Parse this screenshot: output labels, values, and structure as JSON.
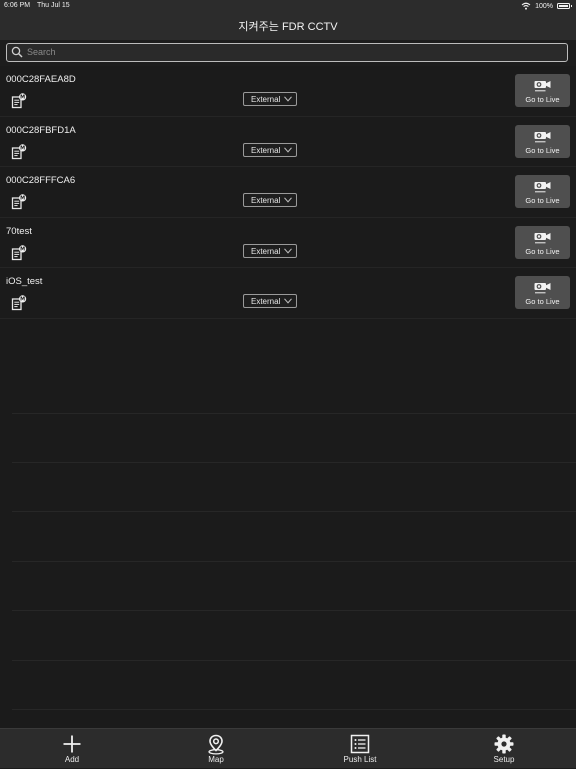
{
  "status_bar": {
    "time": "6:06 PM",
    "date": "Thu Jul 15",
    "battery": "100%"
  },
  "nav": {
    "title": "지켜주는 FDR CCTV"
  },
  "search": {
    "placeholder": "Search",
    "value": ""
  },
  "devices": [
    {
      "name": "000C28FAEA8D",
      "mode": "External",
      "action_label": "Go to Live"
    },
    {
      "name": "000C28FBFD1A",
      "mode": "External",
      "action_label": "Go to Live"
    },
    {
      "name": "000C28FFFCA6",
      "mode": "External",
      "action_label": "Go to Live"
    },
    {
      "name": "70test",
      "mode": "External",
      "action_label": "Go to Live"
    },
    {
      "name": "iOS_test",
      "mode": "External",
      "action_label": "Go to Live"
    }
  ],
  "tabs": [
    {
      "label": "Add",
      "icon": "plus-icon"
    },
    {
      "label": "Map",
      "icon": "map-pin-icon"
    },
    {
      "label": "Push List",
      "icon": "list-icon"
    },
    {
      "label": "Setup",
      "icon": "gear-icon"
    }
  ],
  "icons": {
    "memo": "memo-m-icon",
    "camera": "cctv-camera-icon",
    "wifi": "wifi-icon",
    "battery": "battery-icon",
    "search": "search-icon",
    "chevron": "chevron-down-icon"
  }
}
